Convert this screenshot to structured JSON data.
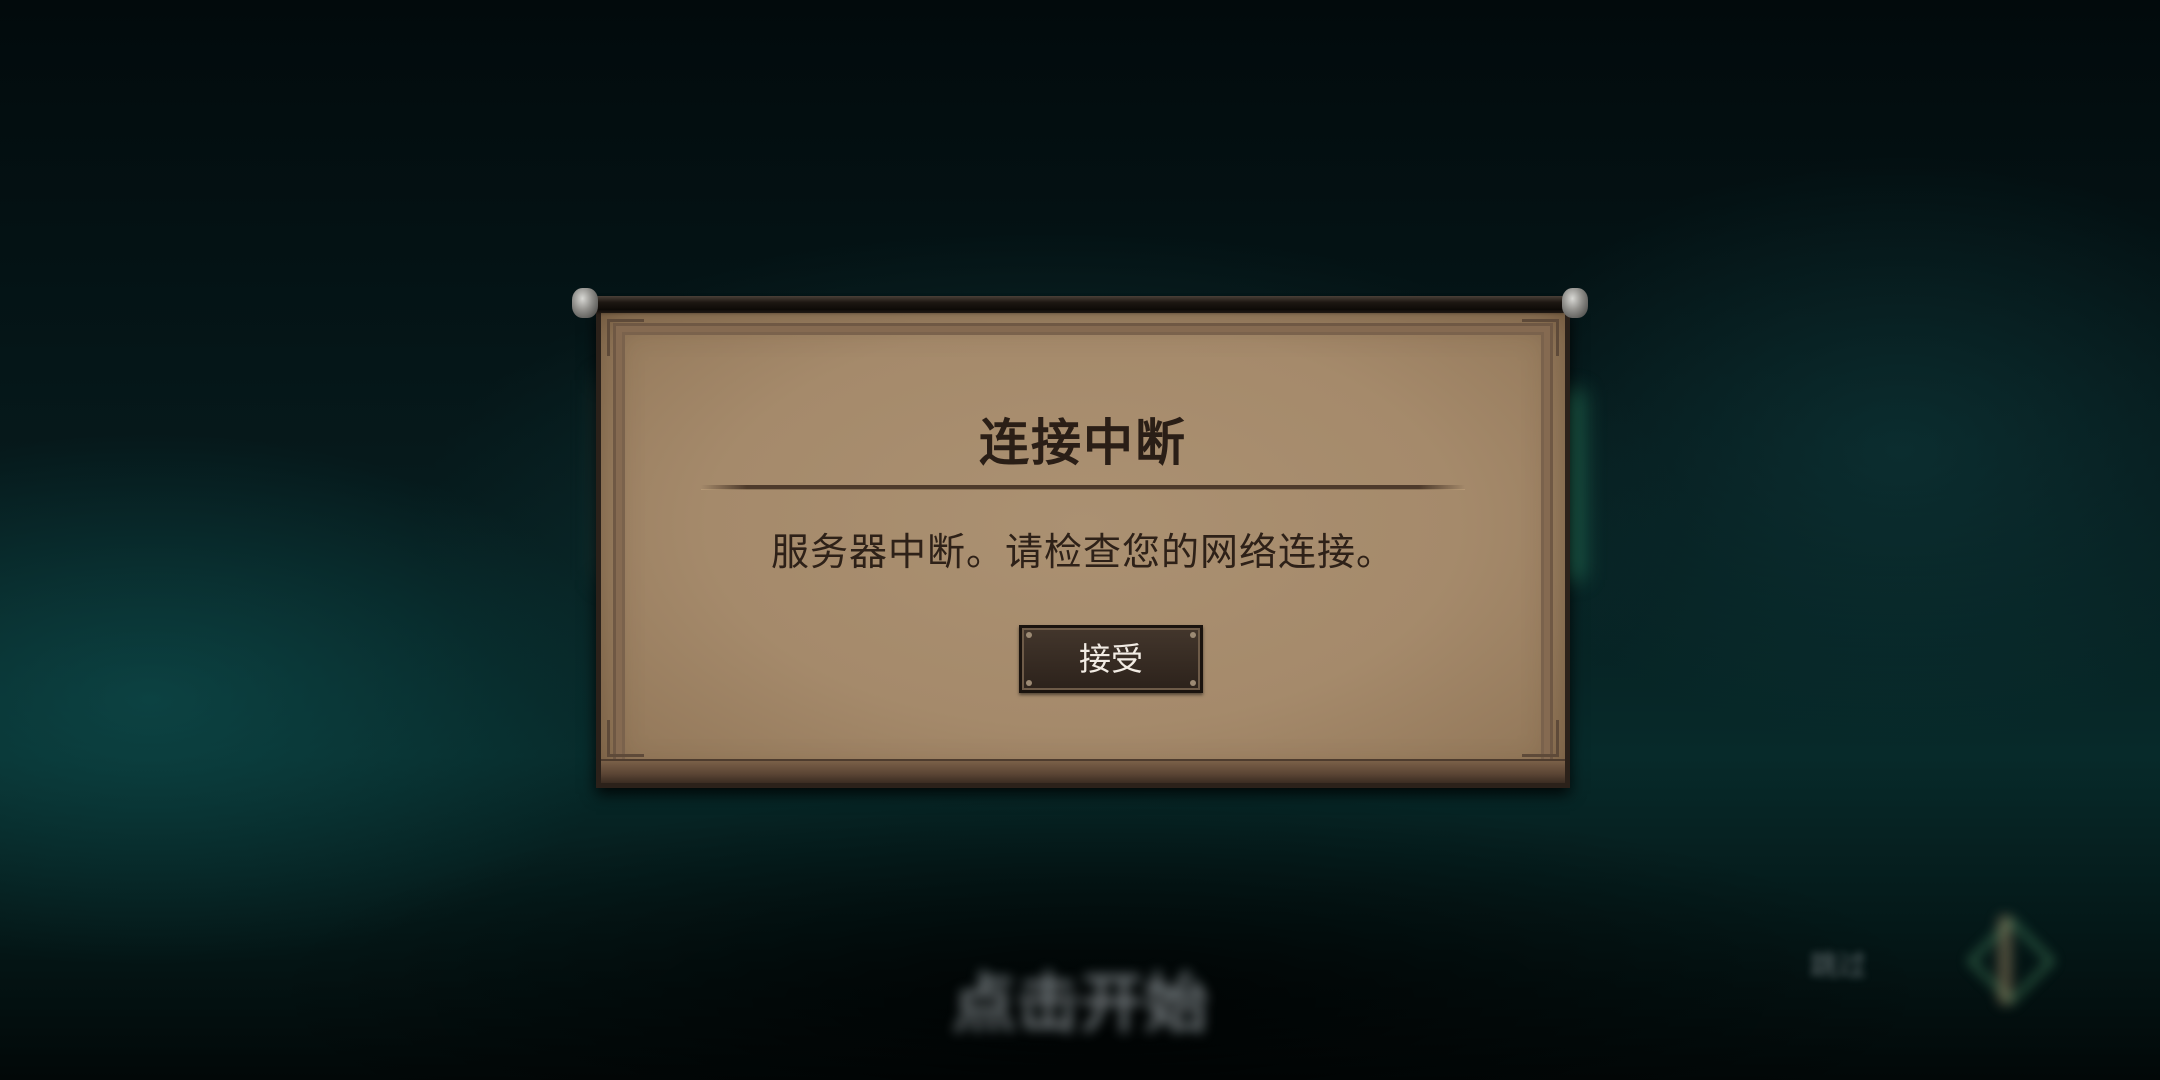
{
  "background": {
    "tap_to_start": "点击开始",
    "skip_label": "跳过"
  },
  "dialog": {
    "title": "连接中断",
    "message": "服务器中断。请检查您的网络连接。",
    "accept_label": "接受"
  },
  "colors": {
    "parchment": "#a58a6b",
    "frame_dark": "#2b211a",
    "button_bg": "#3a2e25",
    "text_dark": "#2a1e16",
    "button_text": "#f2ece4"
  }
}
